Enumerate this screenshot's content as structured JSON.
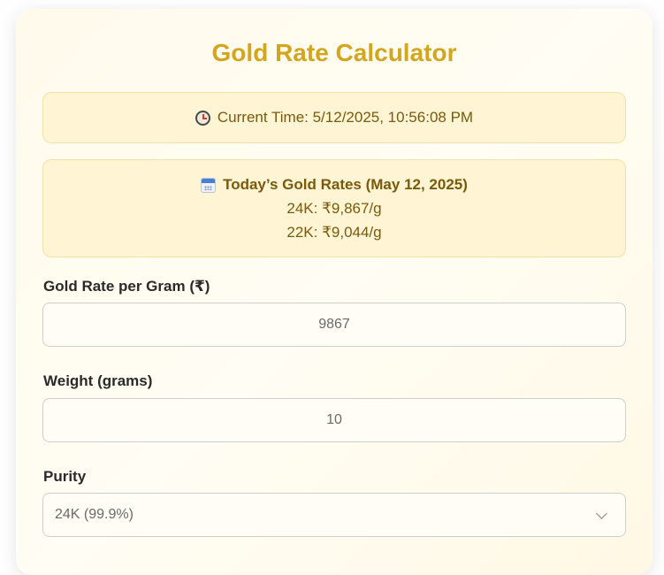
{
  "app": {
    "title": "Gold Rate Calculator"
  },
  "time_box": {
    "icon": "clock-icon",
    "text": "Current Time: 5/12/2025, 10:56:08 PM"
  },
  "rates_box": {
    "icon": "calendar-icon",
    "heading": "Today’s Gold Rates (May 12, 2025)",
    "rate_24k": "24K: ₹9,867/g",
    "rate_22k": "22K: ₹9,044/g"
  },
  "form": {
    "rate_label": "Gold Rate per Gram (₹)",
    "rate_value": "9867",
    "weight_label": "Weight (grams)",
    "weight_value": "10",
    "purity_label": "Purity",
    "purity_selected": "24K (99.9%)"
  },
  "colors": {
    "accent": "#d4a51f",
    "info_bg": "#fff4d3",
    "info_text": "#7a5a0c"
  }
}
